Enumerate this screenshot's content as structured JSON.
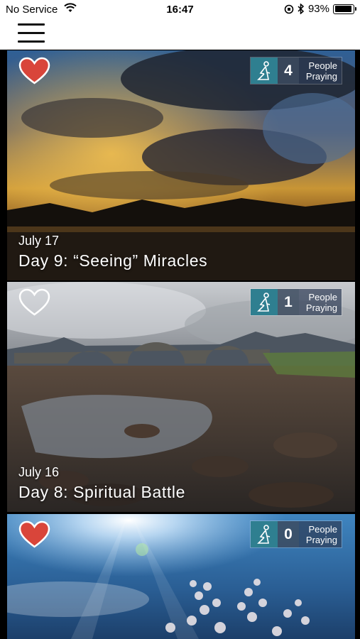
{
  "status_bar": {
    "carrier": "No Service",
    "time": "16:47",
    "battery": "93%",
    "battery_level": 0.93
  },
  "nav": {
    "menu_icon": "hamburger-icon"
  },
  "devotionals": [
    {
      "date": "July 17",
      "title": "Day 9: “Seeing” Miracles",
      "favorited": true,
      "praying_count": "4",
      "praying_label_1": "People",
      "praying_label_2": "Praying",
      "image": "sunset-clouds-over-water"
    },
    {
      "date": "July 16",
      "title": "Day 8: Spiritual Battle",
      "favorited": false,
      "praying_count": "1",
      "praying_label_1": "People",
      "praying_label_2": "Praying",
      "image": "stone-bridge-over-rocky-stream"
    },
    {
      "date": "",
      "title": "",
      "favorited": true,
      "praying_count": "0",
      "praying_label_1": "People",
      "praying_label_2": "Praying",
      "image": "sun-rays-over-frosted-plant"
    }
  ],
  "colors": {
    "heart_filled": "#d9453a",
    "praying_icon_bg": "#2f7f90",
    "praying_count_bg": "#3c4b5f"
  }
}
